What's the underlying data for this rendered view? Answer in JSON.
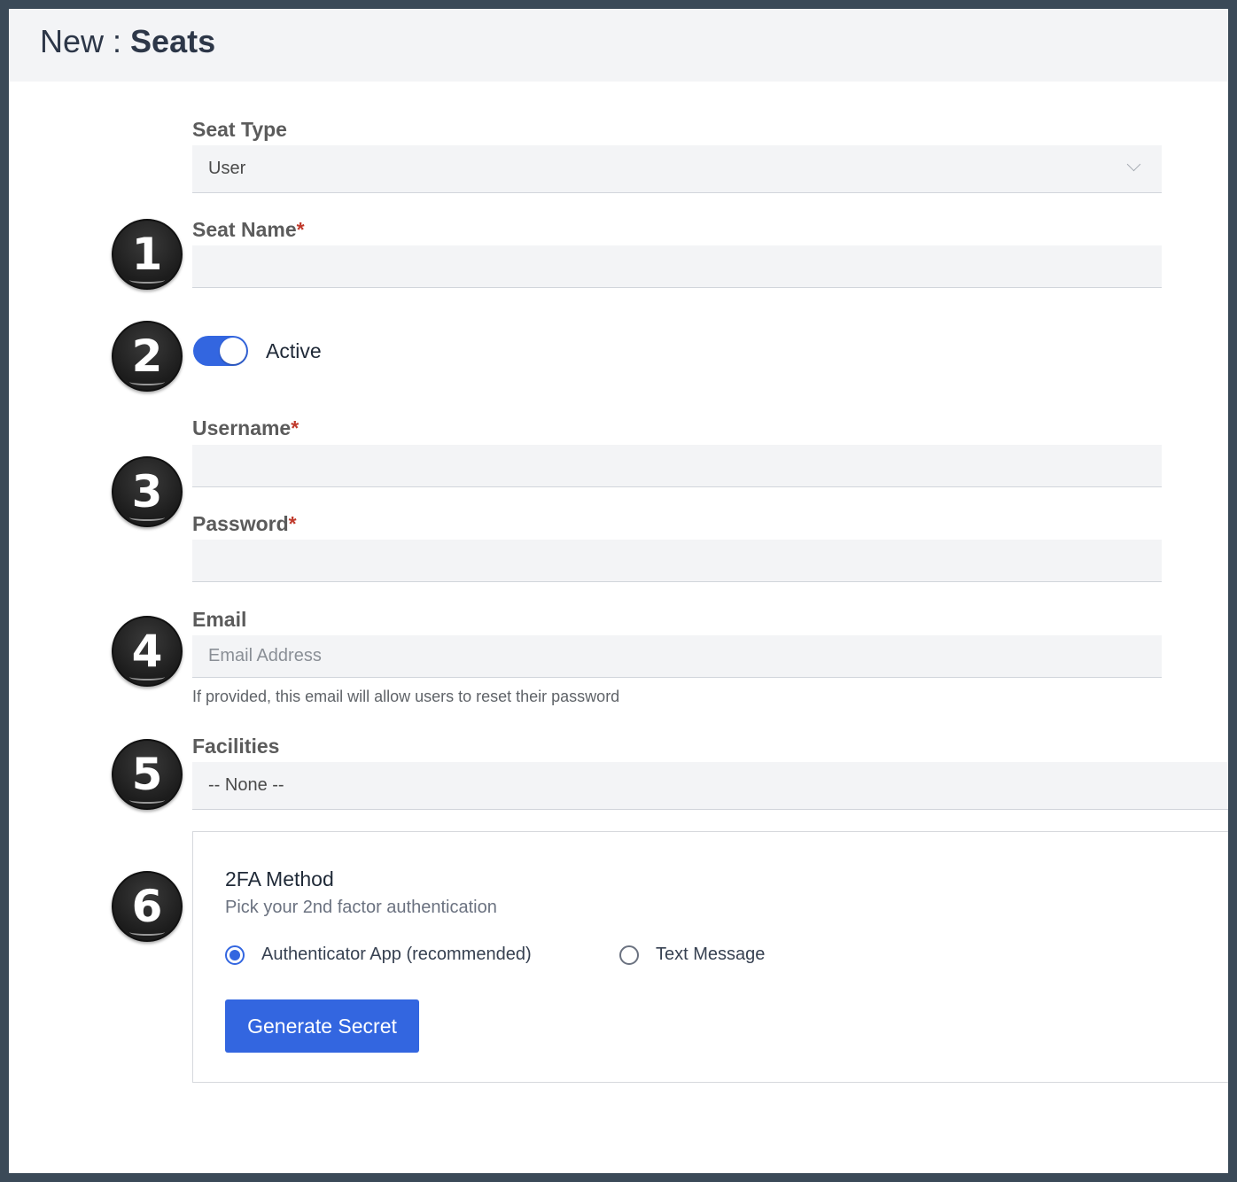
{
  "header": {
    "prefix": "New : ",
    "title": "Seats"
  },
  "seat_type": {
    "label": "Seat Type",
    "value": "User"
  },
  "seat_name": {
    "label": "Seat Name",
    "required_mark": "*",
    "value": ""
  },
  "active": {
    "label": "Active",
    "on": true
  },
  "username": {
    "label": "Username",
    "required_mark": "*",
    "value": ""
  },
  "password": {
    "label": "Password",
    "required_mark": "*",
    "value": ""
  },
  "email": {
    "label": "Email",
    "placeholder": "Email Address",
    "help": "If provided, this email will allow users to reset their password"
  },
  "facilities": {
    "label": "Facilities",
    "value": "-- None --"
  },
  "twofa": {
    "title": "2FA Method",
    "subtitle": "Pick your 2nd factor authentication",
    "options": [
      {
        "label": "Authenticator App (recommended)",
        "selected": true
      },
      {
        "label": "Text Message",
        "selected": false
      }
    ],
    "button": "Generate Secret"
  },
  "badges": [
    "1",
    "2",
    "3",
    "4",
    "5",
    "6"
  ],
  "colors": {
    "accent": "#3366e0",
    "required": "#c0392b",
    "frame": "#3b4a58"
  }
}
